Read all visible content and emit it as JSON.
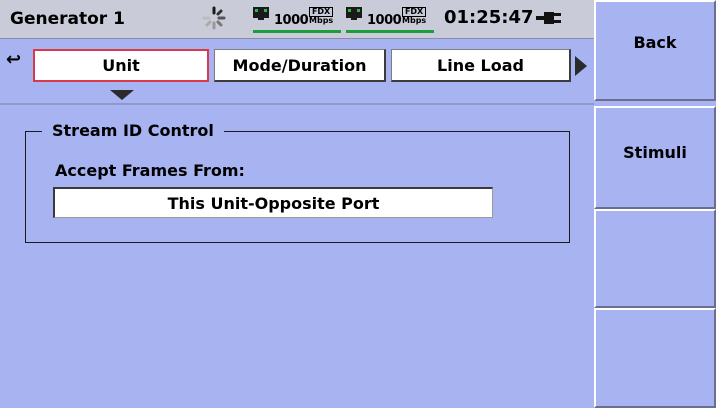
{
  "header": {
    "title": "Generator 1",
    "clock": "01:25:47",
    "ports": [
      {
        "speed": "1000",
        "duplex": "FDX",
        "unit": "Mbps"
      },
      {
        "speed": "1000",
        "duplex": "FDX",
        "unit": "Mbps"
      }
    ],
    "icons": [
      "busy-spinner-icon",
      "ethernet-connector-icon",
      "power-plug-icon"
    ],
    "link_color": "#1a9d3a"
  },
  "tabs": {
    "items": [
      {
        "label": "Unit",
        "selected": true
      },
      {
        "label": "Mode/Duration",
        "selected": false
      },
      {
        "label": "Line Load",
        "selected": false
      }
    ],
    "selected_border_color": "#d93a4a"
  },
  "panel": {
    "group_title": "Stream ID Control",
    "accept_label": "Accept Frames From:",
    "accept_value": "This Unit-Opposite Port"
  },
  "softkeys": {
    "back": "Back",
    "stimuli": "Stimuli",
    "empty_1": "",
    "empty_2": ""
  },
  "colors": {
    "background": "#a8b4f2",
    "titlebar": "#c9ccd8"
  }
}
